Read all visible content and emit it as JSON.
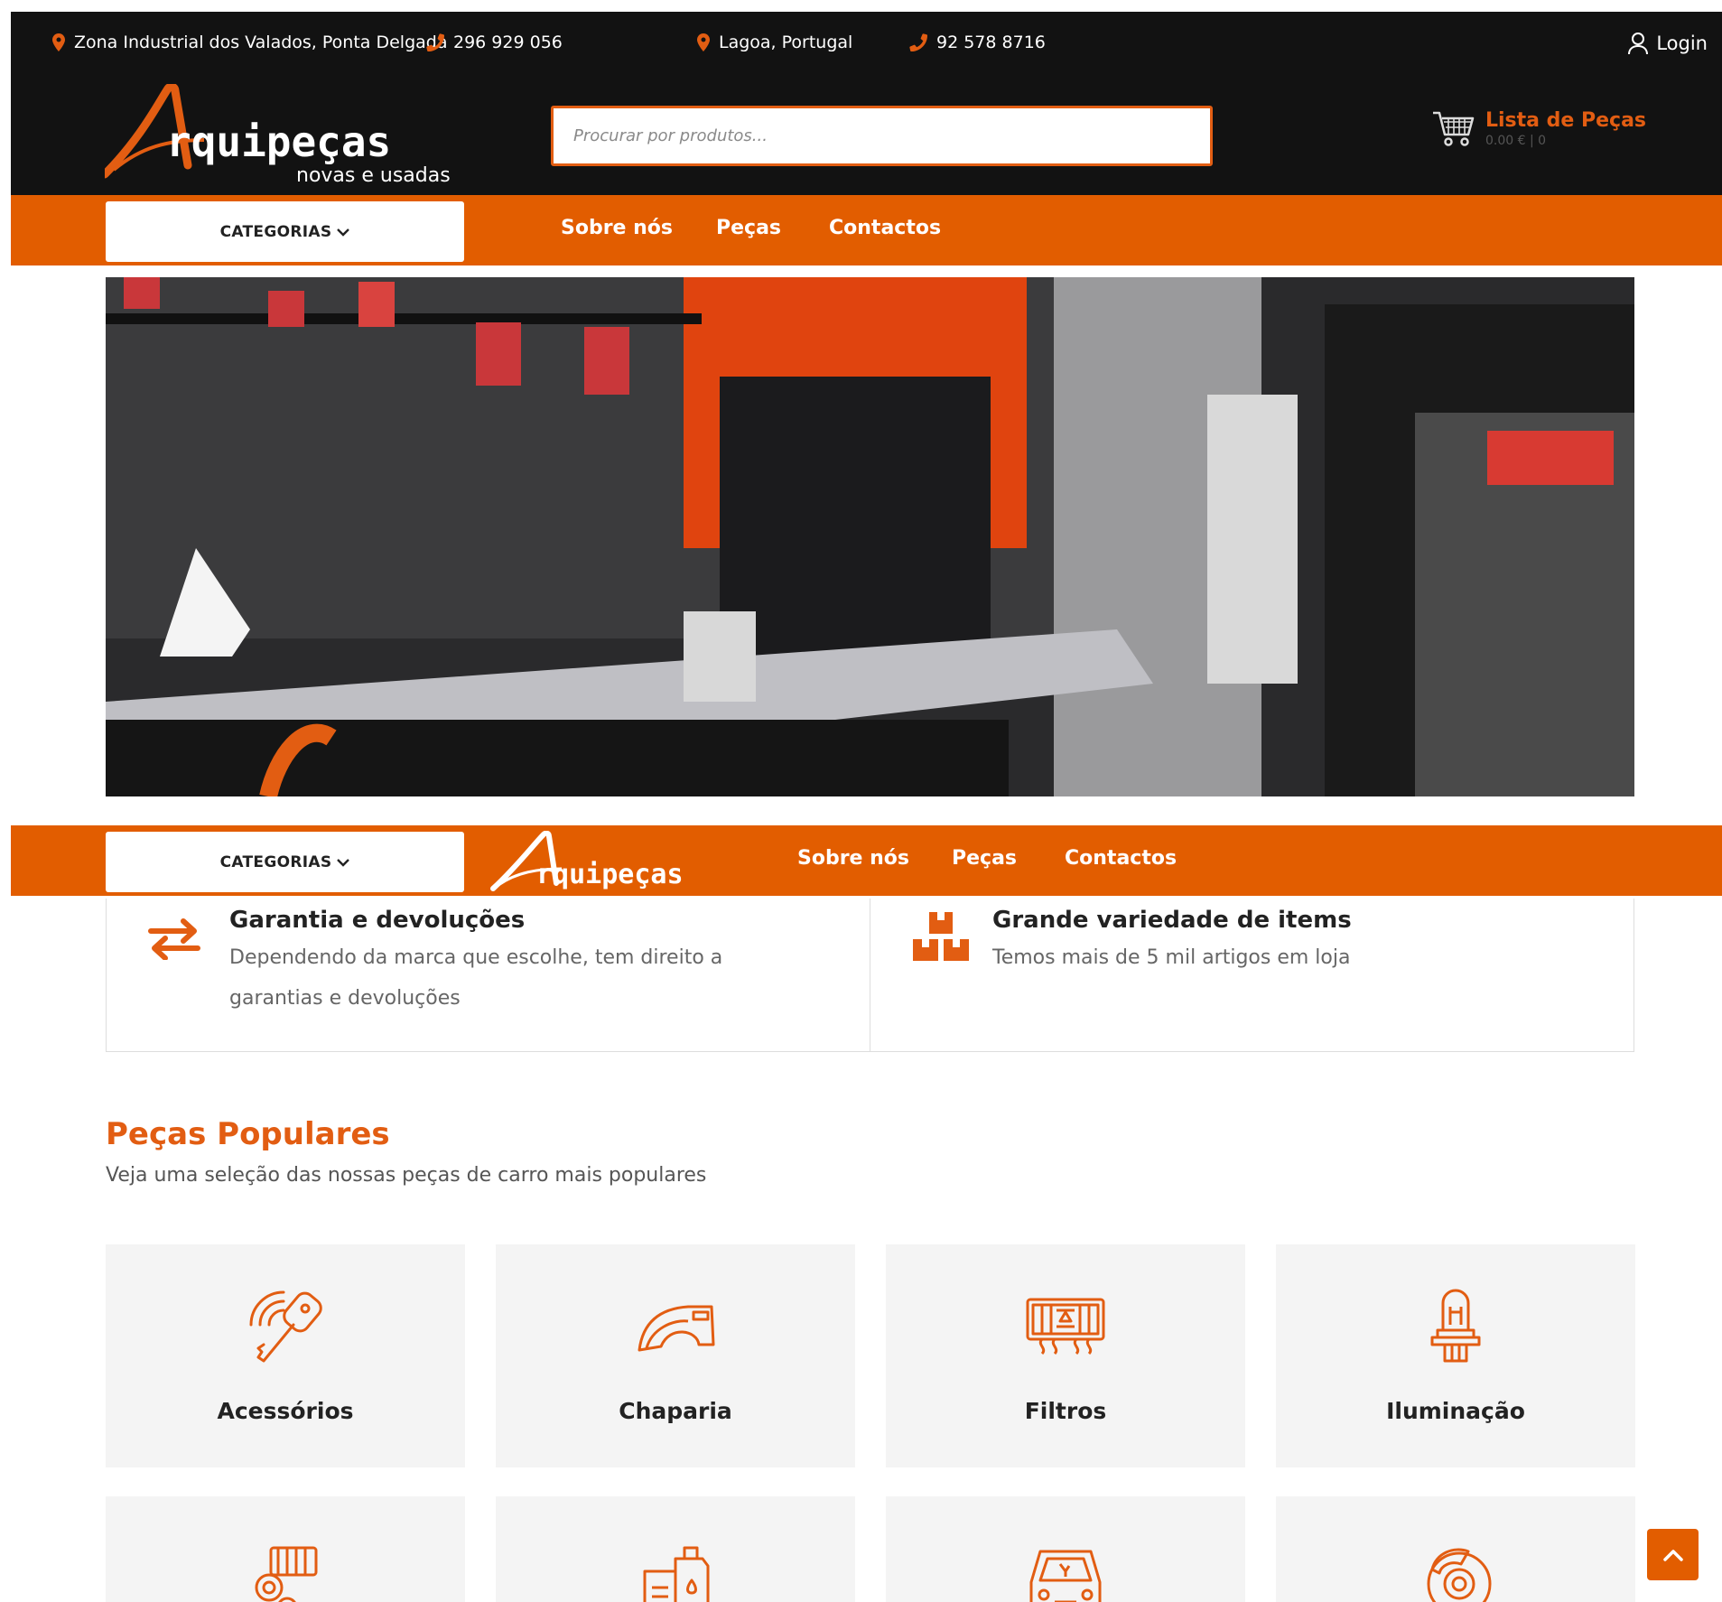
{
  "topbar": {
    "contacts": [
      {
        "icon": "map-pin-icon",
        "text": "Zona Industrial dos Valados, Ponta Delgada"
      },
      {
        "icon": "phone-icon",
        "text": "296 929 056"
      },
      {
        "icon": "map-pin-icon",
        "text": "Lagoa, Portugal"
      },
      {
        "icon": "phone-icon",
        "text": "92 578 8716"
      }
    ],
    "login": "Login"
  },
  "brand": {
    "name": "rquipeças",
    "tagline": "novas e usadas"
  },
  "search": {
    "placeholder": "Procurar por produtos..."
  },
  "cart": {
    "title": "Lista de Peças",
    "summary": "0.00 € | 0"
  },
  "nav": {
    "categories": "CATEGORIAS",
    "links": [
      "Sobre nós",
      "Peças",
      "Contactos"
    ]
  },
  "features": [
    {
      "icon": "arrows-exchange-icon",
      "title": "Garantia e devoluções",
      "desc": "Dependendo da marca que escolhe, tem direito a garantias e devoluções"
    },
    {
      "icon": "boxes-icon",
      "title": "Grande variedade de items",
      "desc": "Temos mais de 5 mil artigos em loja"
    }
  ],
  "popular": {
    "title": "Peças Populares",
    "subtitle": "Veja uma seleção das nossas peças de carro mais populares",
    "cards": [
      {
        "label": "Acessórios",
        "icon": "car-key-icon"
      },
      {
        "label": "Chaparia",
        "icon": "fender-icon"
      },
      {
        "label": "Filtros",
        "icon": "filter-icon"
      },
      {
        "label": "Iluminação",
        "icon": "bulb-icon"
      },
      {
        "label": "",
        "icon": "engine-icon"
      },
      {
        "label": "",
        "icon": "oil-can-icon"
      },
      {
        "label": "",
        "icon": "car-front-icon"
      },
      {
        "label": "",
        "icon": "brake-disc-icon"
      }
    ]
  },
  "colors": {
    "accent": "#e25d00",
    "dark": "#121212"
  }
}
